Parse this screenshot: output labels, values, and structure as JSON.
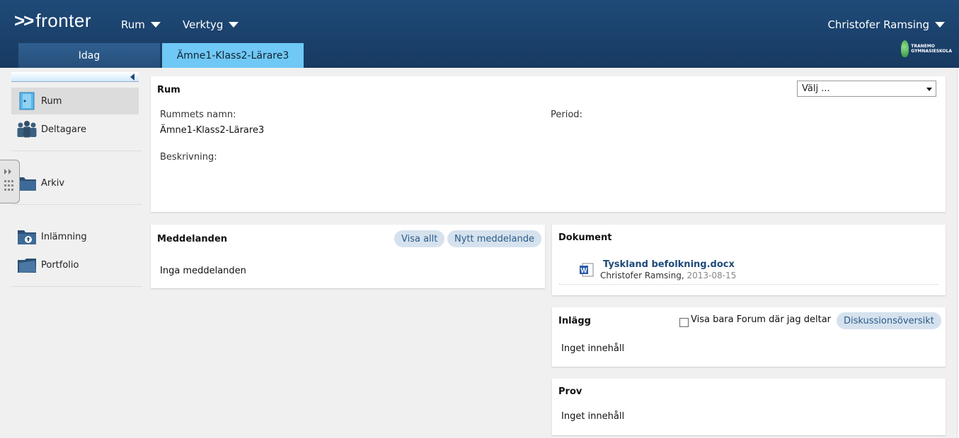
{
  "header": {
    "logo_arrows": ">>",
    "logo_text": "fronter",
    "menu_rum": "Rum",
    "menu_verktyg": "Verktyg",
    "user_name": "Christofer Ramsing",
    "school_logo_text_1": "TRANEMO",
    "school_logo_text_2": "GYMNASIESKOLA"
  },
  "tabs": [
    {
      "label": "Idag"
    },
    {
      "label": "Ämne1-Klass2-Lärare3"
    }
  ],
  "sidebar": {
    "items": [
      {
        "label": "Rum"
      },
      {
        "label": "Deltagare"
      },
      {
        "label": "Arkiv"
      },
      {
        "label": "Inlämning"
      },
      {
        "label": "Portfolio"
      }
    ]
  },
  "room_panel": {
    "title": "Rum",
    "select_value": "Välj ...",
    "name_label": "Rummets namn:",
    "name_value": "Ämne1-Klass2-Lärare3",
    "period_label": "Period:",
    "description_label": "Beskrivning:"
  },
  "messages_panel": {
    "title": "Meddelanden",
    "show_all": "Visa allt",
    "new_message": "Nytt meddelande",
    "empty": "Inga meddelanden"
  },
  "documents_panel": {
    "title": "Dokument",
    "file_name": "Tyskland befolkning.docx",
    "author": "Christofer Ramsing",
    "date": "2013-08-15"
  },
  "posts_panel": {
    "title": "Inlägg",
    "checkbox_label": "Visa bara Forum där jag deltar",
    "overview_button": "Diskussionsöversikt",
    "empty": "Inget innehåll"
  },
  "tests_panel": {
    "title": "Prov",
    "empty": "Inget innehåll"
  }
}
